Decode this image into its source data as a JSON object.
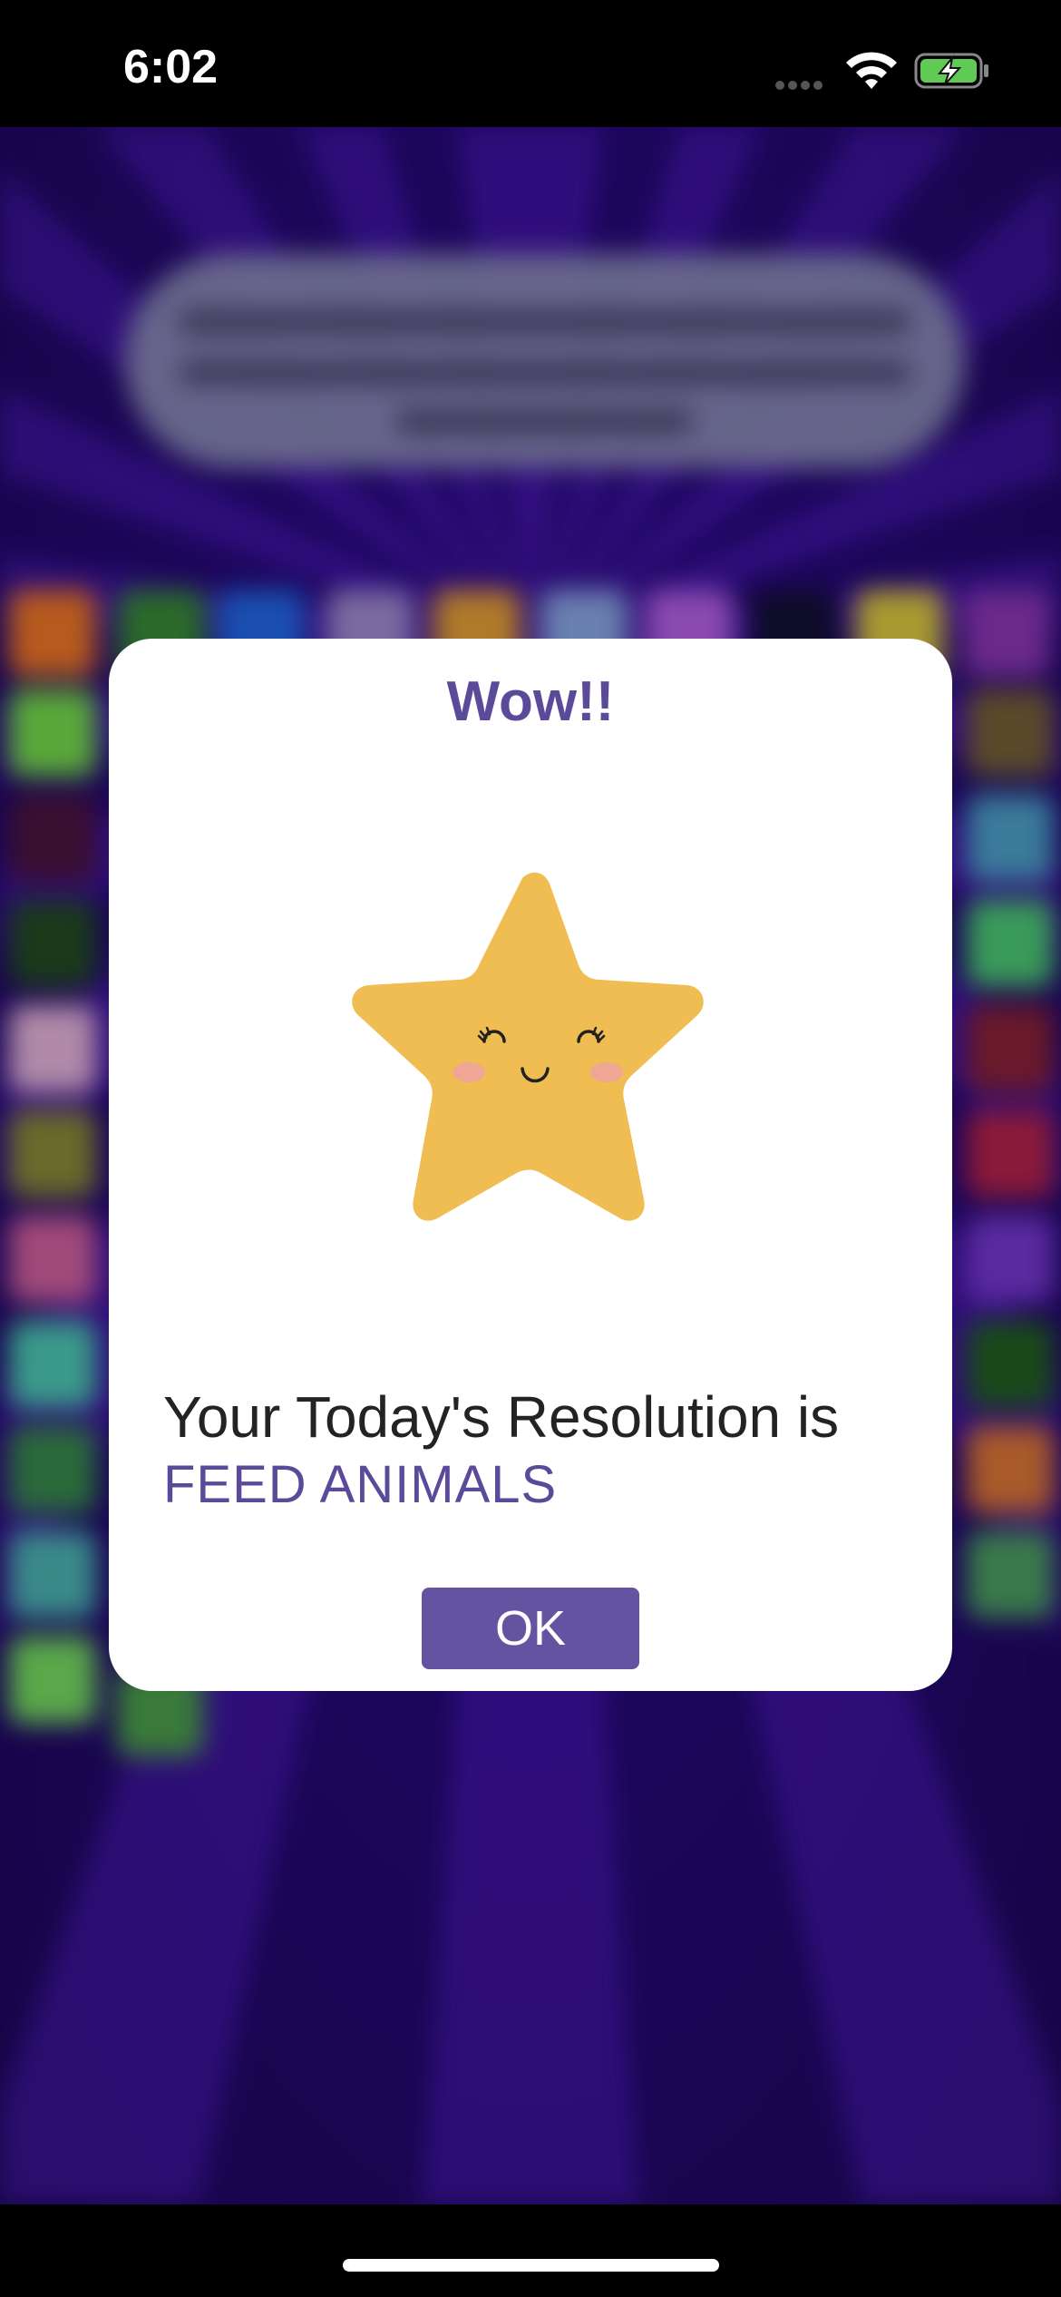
{
  "status_bar": {
    "time": "6:02",
    "wifi_icon": "wifi-icon",
    "battery_icon": "battery-charging-icon"
  },
  "dialog": {
    "title": "Wow!!",
    "illustration": "smiling-star-icon",
    "resolution_label": "Your Today's Resolution is",
    "resolution_value": "FEED ANIMALS",
    "ok_label": "OK"
  },
  "colors": {
    "accent": "#5b4a9a",
    "button": "#6453a1",
    "star": "#efbd52",
    "background": "#1e0660"
  }
}
